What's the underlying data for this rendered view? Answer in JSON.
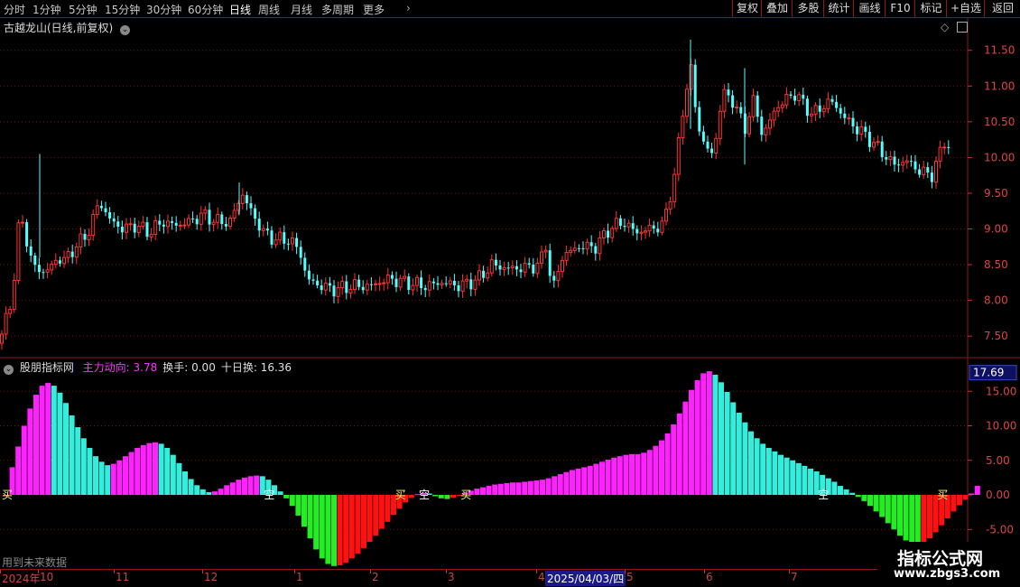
{
  "toolbar": {
    "periods": [
      "分时",
      "1分钟",
      "5分钟",
      "15分钟",
      "30分钟",
      "60分钟",
      "日线",
      "周线",
      "月线",
      "多周期",
      "更多"
    ],
    "active_period": "日线",
    "right_buttons": [
      "复权",
      "叠加",
      "多股",
      "统计",
      "画线",
      "F10",
      "标记",
      "+自选",
      "返回"
    ]
  },
  "main_chart": {
    "title": "古越龙山(日线,前复权)",
    "y_ticks": [
      "11.50",
      "11.00",
      "10.50",
      "10.00",
      "9.50",
      "9.00",
      "8.50",
      "8.00",
      "7.50"
    ],
    "colors": {
      "up": "#ff3333",
      "down": "#54ffff",
      "grid": "#7a1010"
    }
  },
  "indicator": {
    "name": "股朋指标网",
    "fields": [
      {
        "label": "主力动向:",
        "value": "3.78",
        "color": "#ff33ff"
      },
      {
        "label": "换手:",
        "value": "0.00",
        "color": "#dddddd"
      },
      {
        "label": "十日换:",
        "value": "16.36",
        "color": "#dddddd"
      }
    ],
    "current_value_badge": "17.69",
    "y_ticks": [
      "15.00",
      "10.00",
      "5.00",
      "0.00",
      "-5.00"
    ],
    "signals": [
      "买",
      "空",
      "买",
      "空",
      "买",
      "空",
      "买"
    ],
    "future_note": "用到未来数据",
    "colors": {
      "pos_up": "#ff22ff",
      "pos_down": "#33eedd",
      "neg_down": "#22ee22",
      "neg_up": "#ff1111"
    }
  },
  "date_axis": {
    "labels": [
      "2024年",
      "10",
      "11",
      "12",
      "1",
      "2",
      "3",
      "4",
      "2025/04/03/四",
      "5",
      "6",
      "7"
    ]
  },
  "watermark": {
    "title": "指标公式网",
    "url": "www.zbgs3.com"
  },
  "chart_data": {
    "type": "bar",
    "title": "",
    "xlabel": "",
    "ylabel": "",
    "ylim": [
      -7,
      18
    ],
    "series": [
      {
        "values": [
          0,
          4,
          7,
          10,
          12.5,
          14.5,
          15.8,
          16.2,
          15.8,
          14.8,
          13.3,
          11.5,
          9.8,
          8.2,
          6.8,
          5.6,
          4.8,
          4.3,
          4.5,
          5,
          5.6,
          6.2,
          6.8,
          7.2,
          7.5,
          7.6,
          7.4,
          6.8,
          5.8,
          4.6,
          3.4,
          2.3,
          1.4,
          0.8,
          0.4,
          0.5,
          0.9,
          1.4,
          1.8,
          2.2,
          2.5,
          2.7,
          2.8,
          2.7,
          2.2,
          1.4,
          0.5,
          -0.5,
          -1.6,
          -3,
          -4.6,
          -6.3,
          -7.9,
          -9.2,
          -10,
          -10.3,
          -10.2,
          -9.8,
          -9.2,
          -8.5,
          -7.7,
          -6.8,
          -5.9,
          -4.9,
          -3.9,
          -2.9,
          -2,
          -1.1,
          -0.4,
          0.1,
          0.3,
          0.2,
          -0.2,
          -0.5,
          -0.6,
          -0.4,
          -0.1,
          0.3,
          0.6,
          0.9,
          1.1,
          1.3,
          1.5,
          1.6,
          1.7,
          1.8,
          1.8,
          1.9,
          2,
          2.1,
          2.2,
          2.4,
          2.7,
          3,
          3.3,
          3.6,
          3.8,
          4,
          4.2,
          4.5,
          4.8,
          5.1,
          5.4,
          5.6,
          5.8,
          5.9,
          5.9,
          6.1,
          6.5,
          7.1,
          7.9,
          8.9,
          10.2,
          11.8,
          13.5,
          15.2,
          16.6,
          17.6,
          17.9,
          17.4,
          16.3,
          14.9,
          13.4,
          11.9,
          10.5,
          9.2,
          8.2,
          7.4,
          6.8,
          6.3,
          5.8,
          5.4,
          5,
          4.6,
          4.2,
          3.8,
          3.4,
          2.9,
          2.4,
          1.9,
          1.3,
          0.8,
          0.3,
          -0.3,
          -0.9,
          -1.6,
          -2.4,
          -3.2,
          -4.1,
          -5,
          -5.9,
          -6.6,
          -7.1,
          -7.3,
          -7,
          -6.3,
          -5.4,
          -4.4,
          -3.4,
          -2.4,
          -1.5,
          -0.7,
          0.2,
          1.3
        ]
      }
    ]
  }
}
